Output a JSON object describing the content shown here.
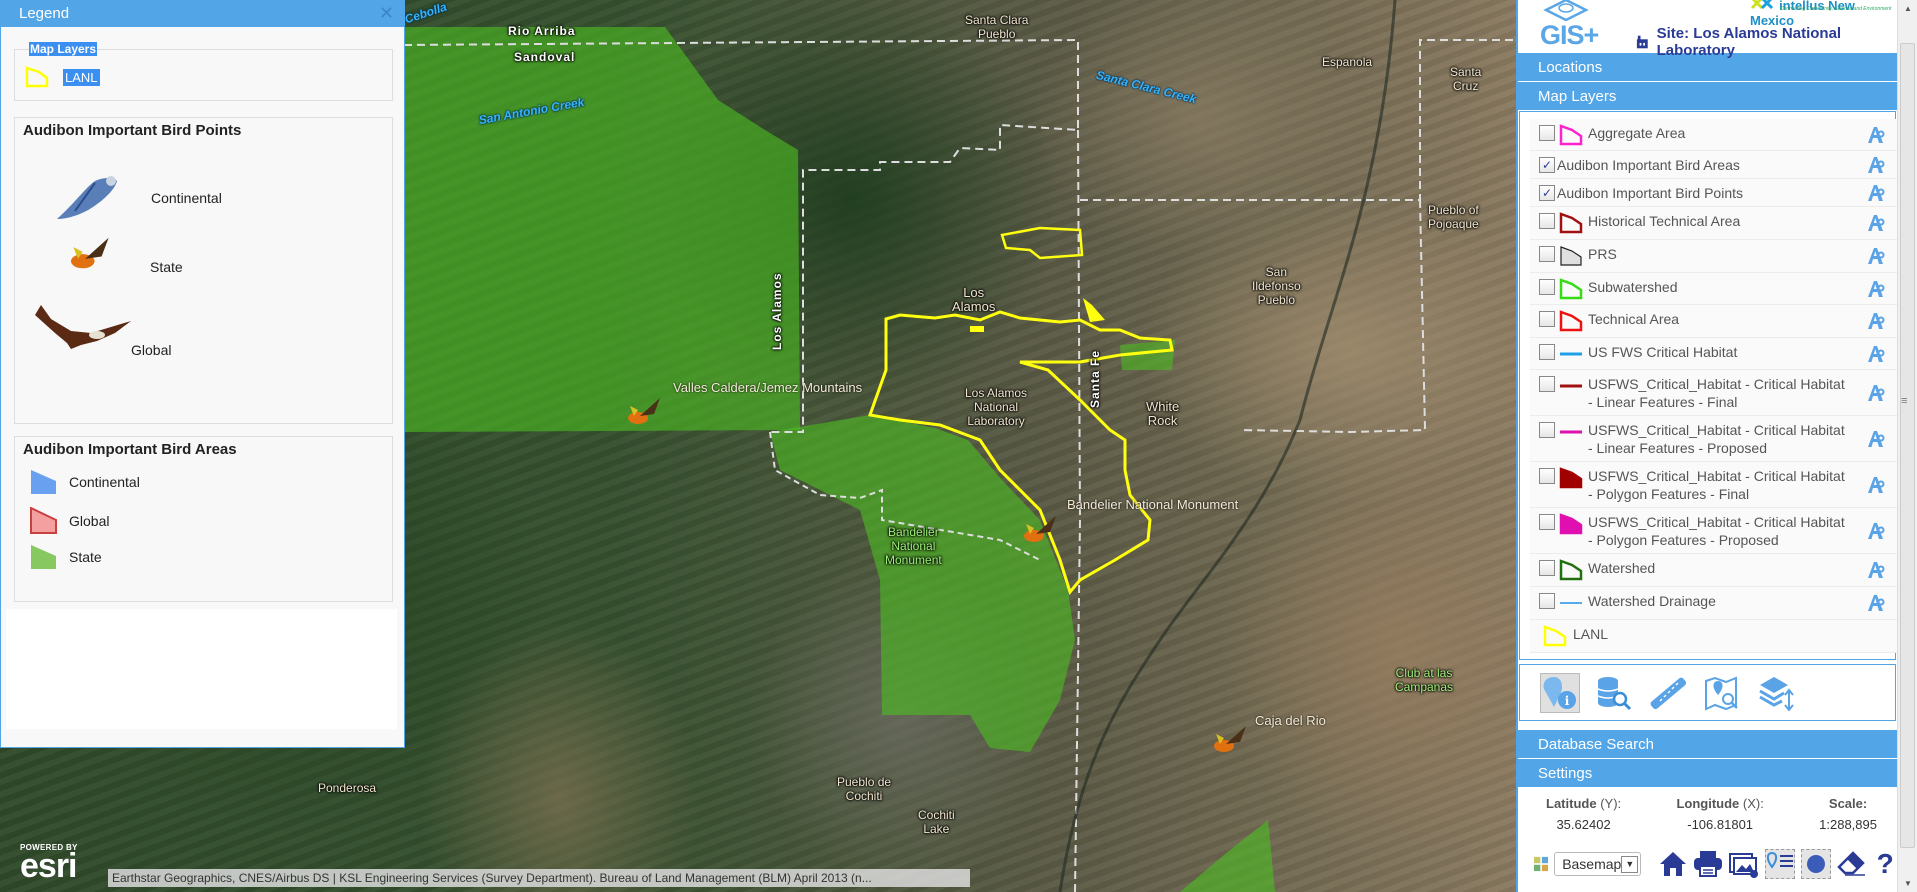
{
  "legend": {
    "title": "Legend",
    "close_icon": "close-icon",
    "map_layers": {
      "title": "Map Layers",
      "items": [
        {
          "label": "LANL",
          "symbol": "yellow-polygon"
        }
      ]
    },
    "bird_points": {
      "title": "Audibon Important Bird Points",
      "items": [
        {
          "label": "Continental",
          "icon": "blue-jay-bird-icon"
        },
        {
          "label": "State",
          "icon": "oriole-bird-icon"
        },
        {
          "label": "Global",
          "icon": "eagle-bird-icon"
        }
      ]
    },
    "bird_areas": {
      "title": "Audibon Important Bird Areas",
      "items": [
        {
          "label": "Continental",
          "fill": "#6aa0f0"
        },
        {
          "label": "Global",
          "fill": "#f4a0a0",
          "stroke": "#c84040"
        },
        {
          "label": "State",
          "fill": "#88c860"
        }
      ]
    }
  },
  "map": {
    "labels": {
      "cebolla": "Cebolla",
      "rio_arriba": "Rio Arriba",
      "sandoval": "Sandoval",
      "san_antonio_creek": "San Antonio Creek",
      "santa_clara_pueblo": "Santa Clara\nPueblo",
      "santa_clara_creek": "Santa Clara Creek",
      "espanola": "Espanola",
      "santa_cruz": "Santa\nCruz",
      "pueblo_pojoaque": "Pueblo of\nPojoaque",
      "san_ildefonso": "San\nIldefonso\nPueblo",
      "los_alamos_county": "Los Alamos",
      "los_alamos_town": "Los\nAlamos",
      "lanl": "Los Alamos\nNational\nLaboratory",
      "santa_fe_county": "Santa Fe",
      "white_rock": "White\nRock",
      "valles_caldera": "Valles Caldera/Jemez Mountains",
      "bandelier_point": "Bandelier National Monument",
      "bandelier_area": "Bandelier\nNational\nMonument",
      "ponderosa": "Ponderosa",
      "pueblo_cochiti": "Pueblo de\nCochiti",
      "cochiti_lake": "Cochiti\nLake",
      "caja_del_rio": "Caja del Rio",
      "club_campanas": "Club at las\nCampanas"
    },
    "esri_powered_by": "POWERED BY",
    "esri_brand": "esri",
    "attribution": "Earthstar Geographics, CNES/Airbus DS | KSL Engineering Services (Survey Department). Bureau of Land Management (BLM) April 2013 (n..."
  },
  "panel": {
    "app_name": "GIS+",
    "partner_name": "intellus New Mexico",
    "partner_tagline": "Connecting Community, Science and Environment",
    "site_label": "Site: Los Alamos National Laboratory",
    "sections": {
      "locations": "Locations",
      "map_layers": "Map Layers",
      "database_search": "Database Search",
      "settings": "Settings"
    },
    "layers": [
      {
        "label": "Aggregate Area",
        "checked": false,
        "symbol": "polygon-outline",
        "color": "#ff22cc"
      },
      {
        "label": "Audibon Important Bird Areas",
        "checked": true,
        "symbol": "none"
      },
      {
        "label": "Audibon Important Bird Points",
        "checked": true,
        "symbol": "none"
      },
      {
        "label": "Historical Technical Area",
        "checked": false,
        "symbol": "polygon-outline",
        "color": "#a01010"
      },
      {
        "label": "PRS",
        "checked": false,
        "symbol": "polygon-filled",
        "color": "#222222",
        "fill": "#e0e0e0"
      },
      {
        "label": "Subwatershed",
        "checked": false,
        "symbol": "polygon-outline",
        "color": "#33dd11"
      },
      {
        "label": "Technical Area",
        "checked": false,
        "symbol": "polygon-outline",
        "color": "#ee1111"
      },
      {
        "label": "US FWS Critical Habitat",
        "checked": false,
        "symbol": "line",
        "color": "#1ea0e8"
      },
      {
        "label": "USFWS_Critical_Habitat - Critical Habitat - Linear Features - Final",
        "checked": false,
        "symbol": "line",
        "color": "#a01010"
      },
      {
        "label": "USFWS_Critical_Habitat - Critical Habitat - Linear Features - Proposed",
        "checked": false,
        "symbol": "line",
        "color": "#e010b0"
      },
      {
        "label": "USFWS_Critical_Habitat - Critical Habitat - Polygon Features - Final",
        "checked": false,
        "symbol": "polygon-solid",
        "color": "#a00000"
      },
      {
        "label": "USFWS_Critical_Habitat - Critical Habitat - Polygon Features - Proposed",
        "checked": false,
        "symbol": "polygon-solid",
        "color": "#e010b0"
      },
      {
        "label": "Watershed",
        "checked": false,
        "symbol": "polygon-outline",
        "color": "#207010"
      },
      {
        "label": "Watershed Drainage",
        "checked": false,
        "symbol": "line-thin",
        "color": "#1e90e8"
      },
      {
        "label": "LANL",
        "checked": null,
        "symbol": "polygon-outline",
        "color": "#ffff00"
      }
    ],
    "tools": [
      {
        "name": "identify-tool",
        "icon": "map-pin-info-icon",
        "active": true
      },
      {
        "name": "database-query-tool",
        "icon": "database-search-icon",
        "active": false
      },
      {
        "name": "measure-tool",
        "icon": "ruler-icon",
        "active": false
      },
      {
        "name": "map-search-tool",
        "icon": "map-search-icon",
        "active": false
      },
      {
        "name": "layer-order-tool",
        "icon": "layers-sort-icon",
        "active": false
      }
    ],
    "coords": {
      "latitude_label": "Latitude",
      "latitude_axis": "(Y):",
      "latitude_value": "35.62402",
      "longitude_label": "Longitude",
      "longitude_axis": "(X):",
      "longitude_value": "-106.81801",
      "scale_label": "Scale:",
      "scale_value": "1:288,895"
    },
    "basemap": {
      "selected": "Basemap"
    },
    "bottom_tools": [
      "home-icon",
      "print-icon",
      "export-image-icon",
      "location-list-icon",
      "select-circle-icon",
      "eraser-icon",
      "help-icon"
    ],
    "accent_color": "#52a6e8",
    "title_color": "#2a3b96"
  }
}
